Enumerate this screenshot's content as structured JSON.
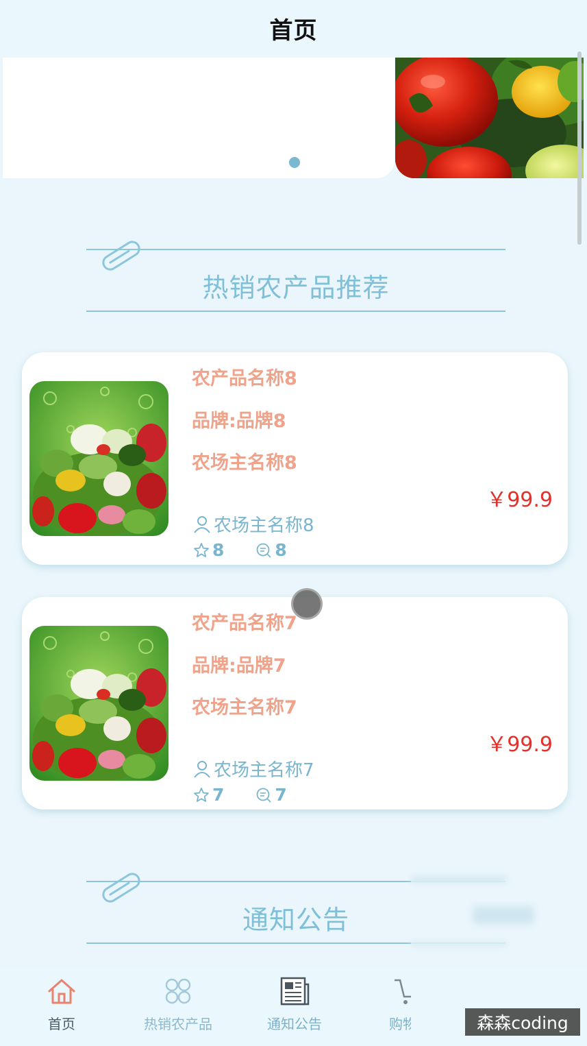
{
  "navbar": {
    "title": "首页"
  },
  "hot_section": {
    "title": "热销农产品推荐"
  },
  "products": [
    {
      "name": "农产品名称8",
      "brand": "品牌:品牌8",
      "farm": "农场主名称8",
      "price": "￥99.9",
      "owner": "农场主名称8",
      "favorites": "8",
      "comments": "8"
    },
    {
      "name": "农产品名称7",
      "brand": "品牌:品牌7",
      "farm": "农场主名称7",
      "price": "￥99.9",
      "owner": "农场主名称7",
      "favorites": "7",
      "comments": "7"
    }
  ],
  "notice_section": {
    "title": "通知公告"
  },
  "tabbar": {
    "items": [
      {
        "label": "首页",
        "icon": "home-icon"
      },
      {
        "label": "热销农产品",
        "icon": "grid-icon"
      },
      {
        "label": "通知公告",
        "icon": "newspaper-icon"
      },
      {
        "label": "购物",
        "icon": "cart-icon"
      }
    ]
  },
  "watermark": "森森coding",
  "colors": {
    "background": "#eaf6fb",
    "accent_blue": "#7fc0d8",
    "title_orange": "#efa38a",
    "price_red": "#e5302b",
    "home_active": "#e8836f"
  }
}
